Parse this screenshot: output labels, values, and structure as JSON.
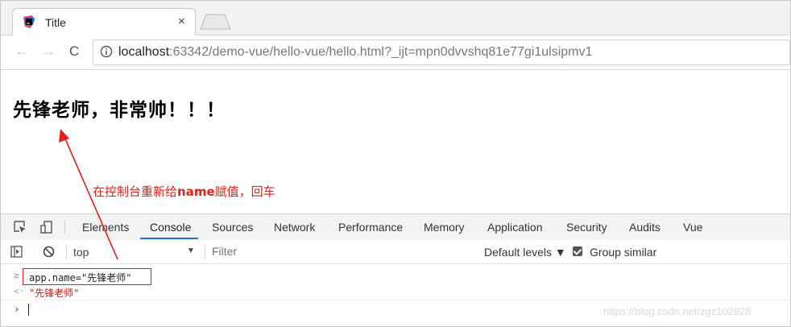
{
  "browser": {
    "tab_title": "Title",
    "tab_close": "×",
    "address_host": "localhost",
    "address_rest": ":63342/demo-vue/hello-vue/hello.html?_ijt=mpn0dvvshq81e77gi1ulsipmv1",
    "nav_back": "←",
    "nav_forward": "→",
    "nav_reload": "C"
  },
  "page": {
    "heading": "先锋老师，非常帅！！！"
  },
  "annotation": {
    "prefix": "在控制台重新给",
    "bold": "name",
    "suffix": "赋值，回车"
  },
  "devtools": {
    "tabs": [
      "Elements",
      "Console",
      "Sources",
      "Network",
      "Performance",
      "Memory",
      "Application",
      "Security",
      "Audits",
      "Vue"
    ],
    "active_tab": "Console",
    "context": "top",
    "filter_placeholder": "Filter",
    "levels": "Default levels ▼",
    "group_similar": "Group similar"
  },
  "console": {
    "input_marker": "≥",
    "command": "app.name=\"先锋老师\"",
    "output_marker": "<·",
    "result": "\"先锋老师\"",
    "prompt": "›"
  },
  "watermark": "https://blog.csdn.net/zgz102928",
  "colors": {
    "annotation_red": "#e0201b",
    "active_tab_blue": "#1a73e8",
    "result_red": "#c41a16"
  }
}
